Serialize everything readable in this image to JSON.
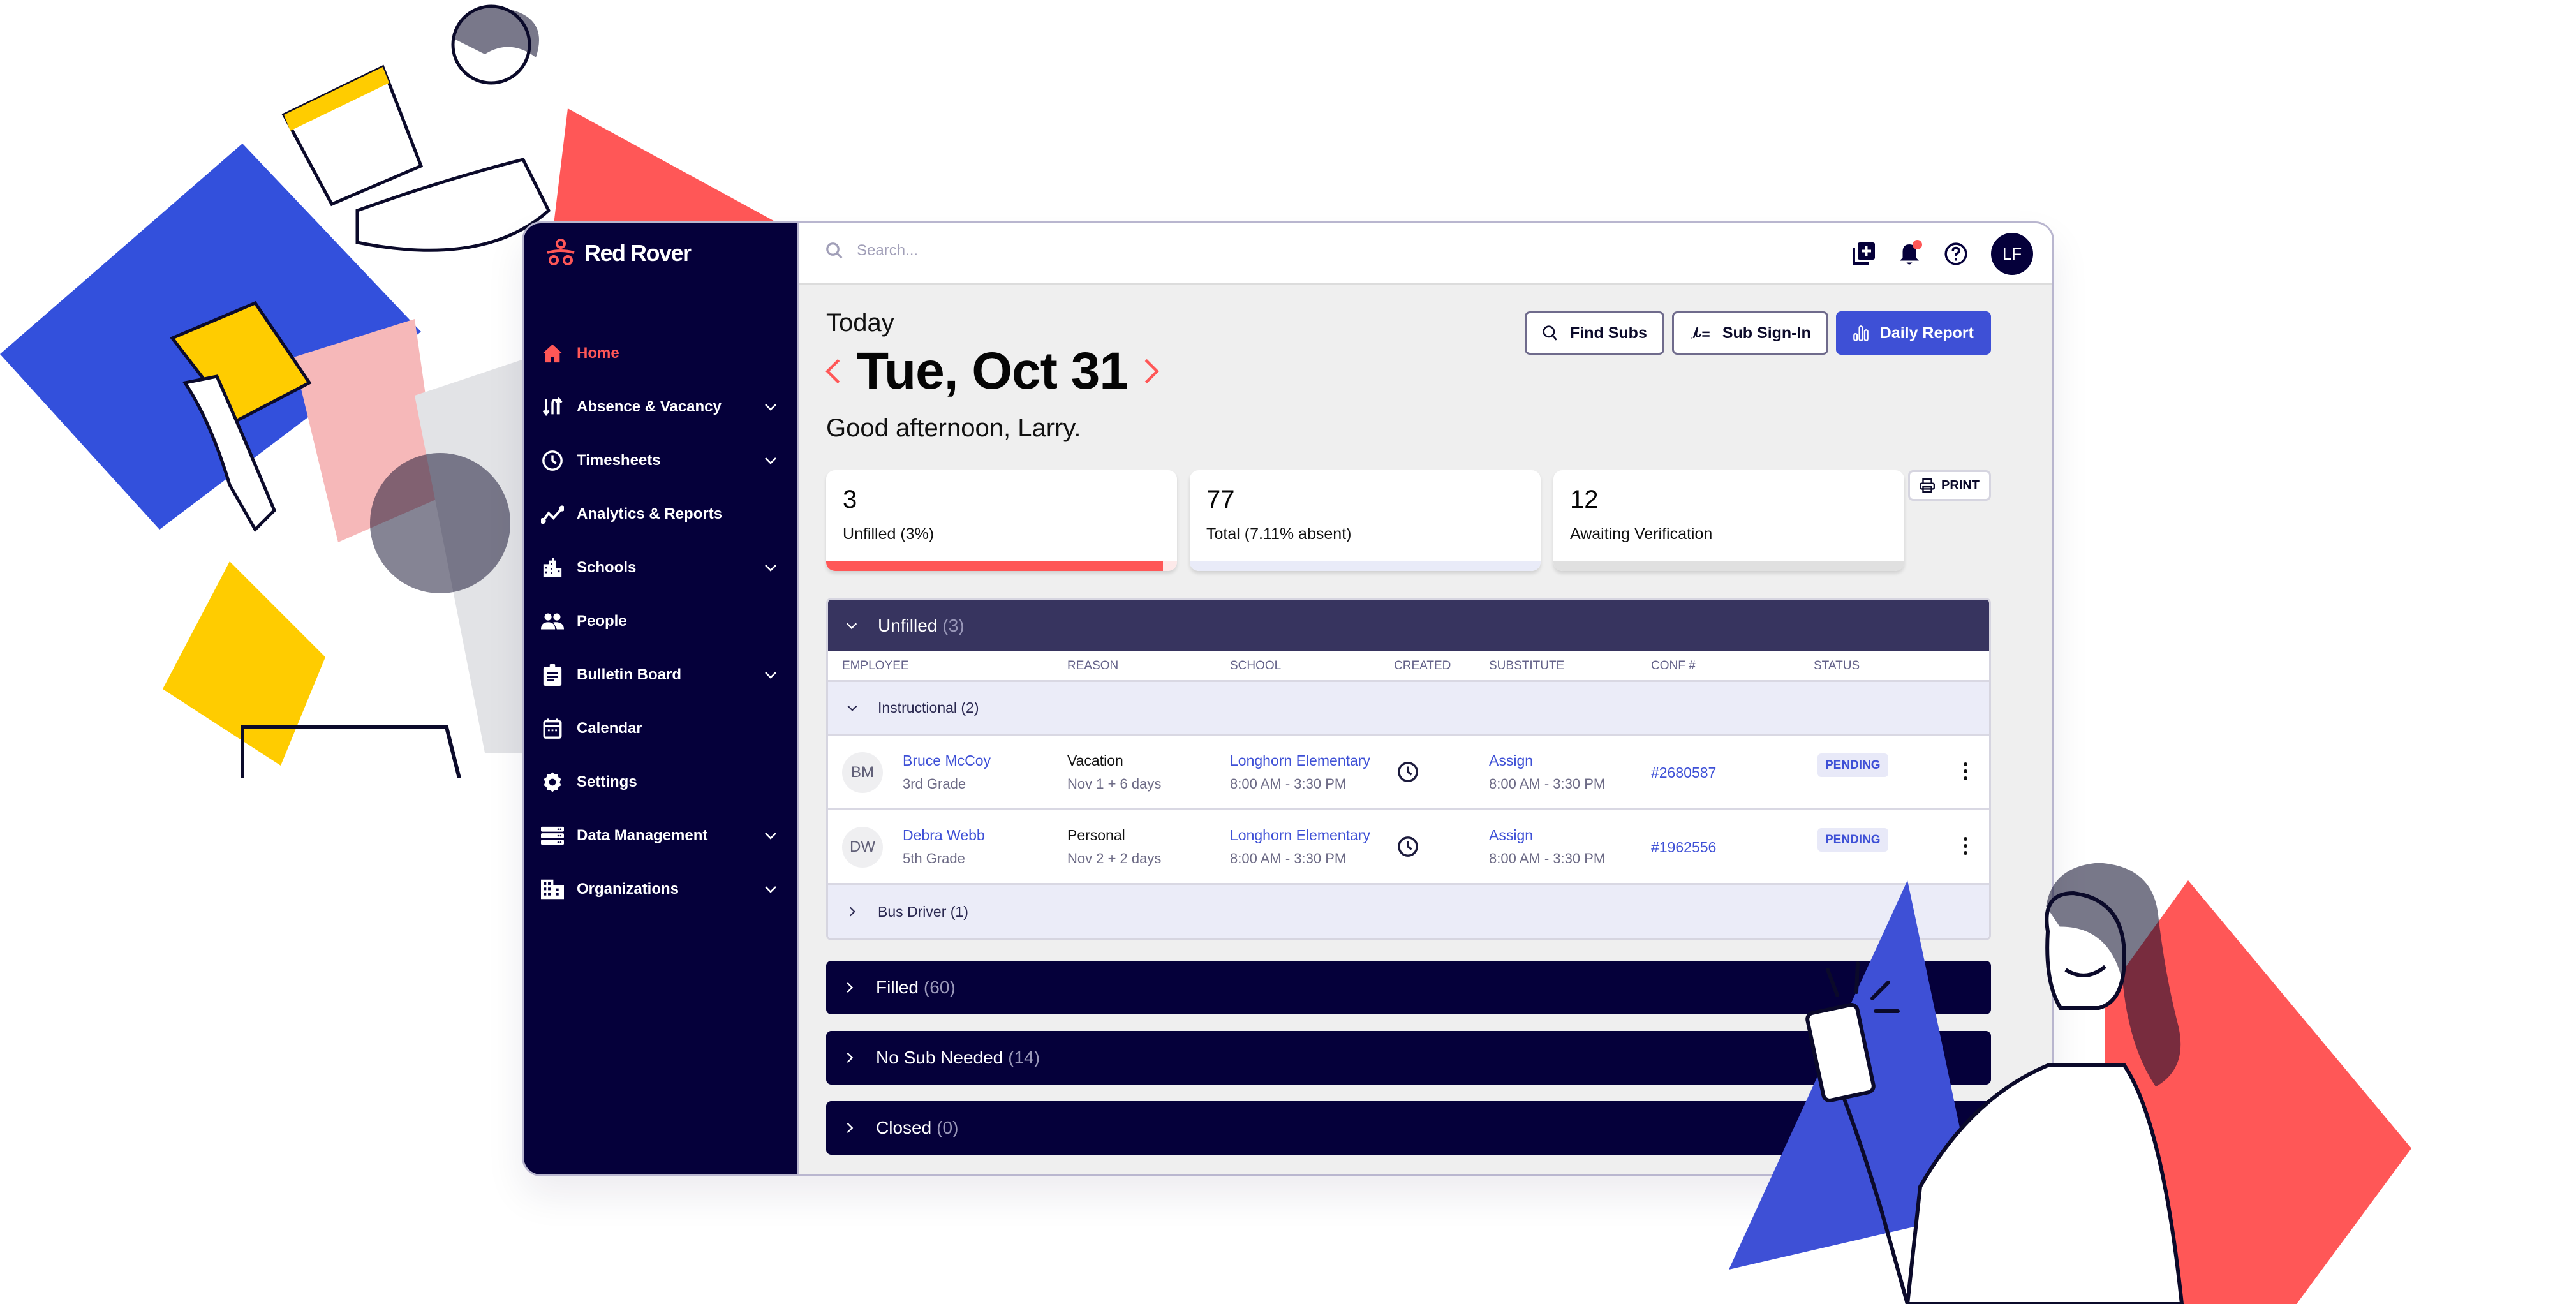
{
  "brand": {
    "name": "Red Rover",
    "accent": "#ff5757",
    "navy": "#05003a",
    "primary_blue": "#3e50d6"
  },
  "sidebar": {
    "items": [
      {
        "label": "Home",
        "icon": "home-icon",
        "active": true,
        "expandable": false
      },
      {
        "label": "Absence & Vacancy",
        "icon": "swap-arrows-icon",
        "active": false,
        "expandable": true
      },
      {
        "label": "Timesheets",
        "icon": "clock-icon",
        "active": false,
        "expandable": true
      },
      {
        "label": "Analytics & Reports",
        "icon": "trend-line-icon",
        "active": false,
        "expandable": false
      },
      {
        "label": "Schools",
        "icon": "school-building-icon",
        "active": false,
        "expandable": true
      },
      {
        "label": "People",
        "icon": "people-icon",
        "active": false,
        "expandable": false
      },
      {
        "label": "Bulletin Board",
        "icon": "clipboard-icon",
        "active": false,
        "expandable": true
      },
      {
        "label": "Calendar",
        "icon": "calendar-icon",
        "active": false,
        "expandable": false
      },
      {
        "label": "Settings",
        "icon": "gear-icon",
        "active": false,
        "expandable": false
      },
      {
        "label": "Data Management",
        "icon": "database-icon",
        "active": false,
        "expandable": true
      },
      {
        "label": "Organizations",
        "icon": "organization-icon",
        "active": false,
        "expandable": true
      }
    ]
  },
  "topbar": {
    "search_placeholder": "Search...",
    "icons": [
      "add-box-icon",
      "bell-icon",
      "help-icon"
    ],
    "notification_dot": true,
    "avatar_initials": "LF"
  },
  "header": {
    "today_label": "Today",
    "date": "Tue, Oct 31",
    "greeting": "Good afternoon, Larry.",
    "buttons": {
      "find_subs": "Find Subs",
      "sub_sign_in": "Sub Sign-In",
      "daily_report": "Daily Report"
    }
  },
  "stats": [
    {
      "value": "3",
      "label": "Unfilled (3%)",
      "bar_fill_fraction": 0.96,
      "bar_color": "#ff5757",
      "track_color": "#fde9e9"
    },
    {
      "value": "77",
      "label": "Total (7.11% absent)",
      "bar_fill_fraction": 0,
      "bar_color": "#3e50d6",
      "track_color": "#e9ebf8"
    },
    {
      "value": "12",
      "label": "Awaiting Verification",
      "bar_fill_fraction": 0,
      "bar_color": "#9b9b9b",
      "track_color": "#e0e0e0"
    }
  ],
  "print_label": "PRINT",
  "unfilled_section": {
    "title": "Unfilled",
    "count": "(3)",
    "columns": [
      "EMPLOYEE",
      "REASON",
      "SCHOOL",
      "CREATED",
      "SUBSTITUTE",
      "CONF #",
      "STATUS"
    ],
    "groups": [
      {
        "label": "Instructional (2)",
        "expanded": true,
        "rows": [
          {
            "initials": "BM",
            "name": "Bruce McCoy",
            "position": "3rd Grade",
            "reason": "Vacation",
            "dates": "Nov 1 + 6 days",
            "school": "Longhorn Elementary",
            "school_time": "8:00 AM - 3:30 PM",
            "substitute": "Assign",
            "sub_time": "8:00 AM - 3:30 PM",
            "conf": "#2680587",
            "status": "PENDING"
          },
          {
            "initials": "DW",
            "name": "Debra Webb",
            "position": "5th Grade",
            "reason": "Personal",
            "dates": "Nov 2 + 2 days",
            "school": "Longhorn Elementary",
            "school_time": "8:00 AM - 3:30 PM",
            "substitute": "Assign",
            "sub_time": "8:00 AM - 3:30 PM",
            "conf": "#1962556",
            "status": "PENDING"
          }
        ]
      },
      {
        "label": "Bus Driver (1)",
        "expanded": false,
        "rows": []
      }
    ]
  },
  "collapsed_sections": [
    {
      "title": "Filled",
      "count": "(60)"
    },
    {
      "title": "No Sub Needed",
      "count": "(14)"
    },
    {
      "title": "Closed",
      "count": "(0)"
    }
  ]
}
